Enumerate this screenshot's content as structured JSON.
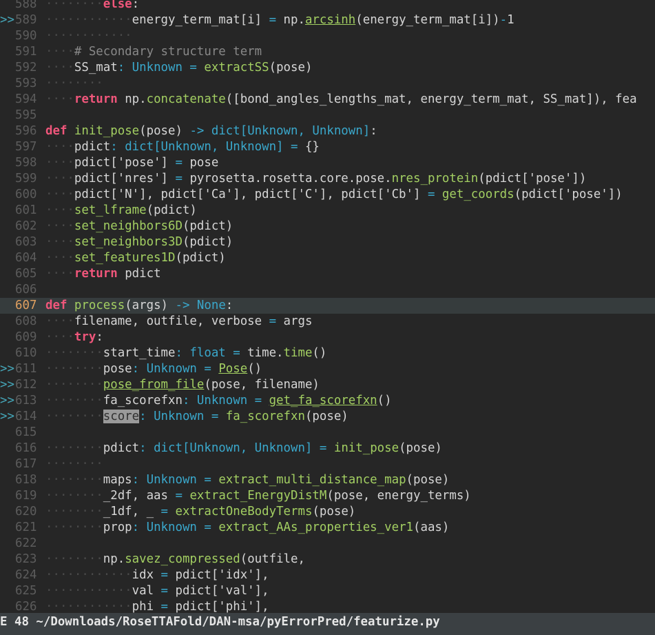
{
  "file_path": "~/Downloads/RoseTTAFold/DAN-msa/pyErrorPred/featurize.py",
  "status_mode": "E",
  "status_count": "48",
  "lines": [
    {
      "n": "588",
      "sign": "",
      "cur": false,
      "t": [
        [
          "ws",
          "········"
        ],
        [
          "kw",
          "else"
        ],
        [
          "plain",
          ":"
        ]
      ]
    },
    {
      "n": "589",
      "sign": ">>",
      "cur": false,
      "t": [
        [
          "ws",
          "············"
        ],
        [
          "plain",
          "energy_term_mat[i] "
        ],
        [
          "ty",
          "="
        ],
        [
          "plain",
          " np."
        ],
        [
          "fn ul",
          "arcsinh"
        ],
        [
          "plain",
          "(energy_term_mat[i])"
        ],
        [
          "ty",
          "-"
        ],
        [
          "plain",
          "1"
        ]
      ]
    },
    {
      "n": "590",
      "sign": "",
      "cur": false,
      "t": [
        [
          "ws",
          "············"
        ]
      ]
    },
    {
      "n": "591",
      "sign": "",
      "cur": false,
      "t": [
        [
          "ws",
          "····"
        ],
        [
          "cm",
          "# Secondary structure term"
        ]
      ]
    },
    {
      "n": "592",
      "sign": "",
      "cur": false,
      "t": [
        [
          "ws",
          "····"
        ],
        [
          "plain",
          "SS_mat"
        ],
        [
          "ty",
          ": Unknown ="
        ],
        [
          "plain",
          " "
        ],
        [
          "fn",
          "extractSS"
        ],
        [
          "plain",
          "(pose)"
        ]
      ]
    },
    {
      "n": "593",
      "sign": "",
      "cur": false,
      "t": [
        [
          "ws",
          "········"
        ]
      ]
    },
    {
      "n": "594",
      "sign": "",
      "cur": false,
      "t": [
        [
          "ws",
          "····"
        ],
        [
          "kw",
          "return"
        ],
        [
          "plain",
          " np."
        ],
        [
          "fn",
          "concatenate"
        ],
        [
          "plain",
          "([bond_angles_lengths_mat, energy_term_mat, SS_mat]), fea"
        ]
      ]
    },
    {
      "n": "595",
      "sign": "",
      "cur": false,
      "t": []
    },
    {
      "n": "596",
      "sign": "",
      "cur": false,
      "t": [
        [
          "kw",
          "def"
        ],
        [
          "plain",
          " "
        ],
        [
          "fn",
          "init_pose"
        ],
        [
          "plain",
          "(pose) "
        ],
        [
          "ty",
          "-> dict[Unknown, Unknown]"
        ],
        [
          "plain",
          ":"
        ]
      ]
    },
    {
      "n": "597",
      "sign": "",
      "cur": false,
      "t": [
        [
          "ws",
          "····"
        ],
        [
          "plain",
          "pdict"
        ],
        [
          "ty",
          ": dict[Unknown, Unknown] ="
        ],
        [
          "plain",
          " {}"
        ]
      ]
    },
    {
      "n": "598",
      "sign": "",
      "cur": false,
      "t": [
        [
          "ws",
          "····"
        ],
        [
          "plain",
          "pdict['pose'] "
        ],
        [
          "ty",
          "="
        ],
        [
          "plain",
          " pose"
        ]
      ]
    },
    {
      "n": "599",
      "sign": "",
      "cur": false,
      "t": [
        [
          "ws",
          "····"
        ],
        [
          "plain",
          "pdict['nres'] "
        ],
        [
          "ty",
          "="
        ],
        [
          "plain",
          " pyrosetta.rosetta.core.pose."
        ],
        [
          "fn",
          "nres_protein"
        ],
        [
          "plain",
          "(pdict['pose'])"
        ]
      ]
    },
    {
      "n": "600",
      "sign": "",
      "cur": false,
      "t": [
        [
          "ws",
          "····"
        ],
        [
          "plain",
          "pdict['N'], pdict['Ca'], pdict['C'], pdict['Cb'] "
        ],
        [
          "ty",
          "="
        ],
        [
          "plain",
          " "
        ],
        [
          "fn",
          "get_coords"
        ],
        [
          "plain",
          "(pdict['pose'])"
        ]
      ]
    },
    {
      "n": "601",
      "sign": "",
      "cur": false,
      "t": [
        [
          "ws",
          "····"
        ],
        [
          "fn",
          "set_lframe"
        ],
        [
          "plain",
          "(pdict)"
        ]
      ]
    },
    {
      "n": "602",
      "sign": "",
      "cur": false,
      "t": [
        [
          "ws",
          "····"
        ],
        [
          "fn",
          "set_neighbors6D"
        ],
        [
          "plain",
          "(pdict)"
        ]
      ]
    },
    {
      "n": "603",
      "sign": "",
      "cur": false,
      "t": [
        [
          "ws",
          "····"
        ],
        [
          "fn",
          "set_neighbors3D"
        ],
        [
          "plain",
          "(pdict)"
        ]
      ]
    },
    {
      "n": "604",
      "sign": "",
      "cur": false,
      "t": [
        [
          "ws",
          "····"
        ],
        [
          "fn",
          "set_features1D"
        ],
        [
          "plain",
          "(pdict)"
        ]
      ]
    },
    {
      "n": "605",
      "sign": "",
      "cur": false,
      "t": [
        [
          "ws",
          "····"
        ],
        [
          "kw",
          "return"
        ],
        [
          "plain",
          " pdict"
        ]
      ]
    },
    {
      "n": "606",
      "sign": "",
      "cur": false,
      "t": []
    },
    {
      "n": "607",
      "sign": "",
      "cur": true,
      "t": [
        [
          "kw",
          "def"
        ],
        [
          "plain",
          " "
        ],
        [
          "fn",
          "process"
        ],
        [
          "plain",
          "(args) "
        ],
        [
          "ty",
          "-> None"
        ],
        [
          "plain",
          ":"
        ]
      ]
    },
    {
      "n": "608",
      "sign": "",
      "cur": false,
      "t": [
        [
          "ws",
          "····"
        ],
        [
          "plain",
          "filename, outfile, verbose "
        ],
        [
          "ty",
          "="
        ],
        [
          "plain",
          " args"
        ]
      ]
    },
    {
      "n": "609",
      "sign": "",
      "cur": false,
      "t": [
        [
          "ws",
          "····"
        ],
        [
          "kw",
          "try"
        ],
        [
          "plain",
          ":"
        ]
      ]
    },
    {
      "n": "610",
      "sign": "",
      "cur": false,
      "t": [
        [
          "ws",
          "········"
        ],
        [
          "plain",
          "start_time"
        ],
        [
          "ty",
          ": float ="
        ],
        [
          "plain",
          " time."
        ],
        [
          "fn",
          "time"
        ],
        [
          "plain",
          "()"
        ]
      ]
    },
    {
      "n": "611",
      "sign": ">>",
      "cur": false,
      "t": [
        [
          "ws",
          "········"
        ],
        [
          "plain",
          "pose"
        ],
        [
          "ty",
          ": Unknown ="
        ],
        [
          "plain",
          " "
        ],
        [
          "fn ul",
          "Pose"
        ],
        [
          "plain",
          "()"
        ]
      ]
    },
    {
      "n": "612",
      "sign": ">>",
      "cur": false,
      "t": [
        [
          "ws",
          "········"
        ],
        [
          "fn ul",
          "pose_from_file"
        ],
        [
          "plain",
          "(pose, filename)"
        ]
      ]
    },
    {
      "n": "613",
      "sign": ">>",
      "cur": false,
      "t": [
        [
          "ws",
          "········"
        ],
        [
          "plain",
          "fa_scorefxn"
        ],
        [
          "ty",
          ": Unknown ="
        ],
        [
          "plain",
          " "
        ],
        [
          "fn ul",
          "get_fa_scorefxn"
        ],
        [
          "plain",
          "()"
        ]
      ]
    },
    {
      "n": "614",
      "sign": ">>",
      "cur": false,
      "t": [
        [
          "ws",
          "········"
        ],
        [
          "hl",
          "score"
        ],
        [
          "ty",
          ": Unknown ="
        ],
        [
          "plain",
          " "
        ],
        [
          "fn",
          "fa_scorefxn"
        ],
        [
          "plain",
          "(pose)"
        ]
      ]
    },
    {
      "n": "615",
      "sign": "",
      "cur": false,
      "t": []
    },
    {
      "n": "616",
      "sign": "",
      "cur": false,
      "t": [
        [
          "ws",
          "········"
        ],
        [
          "plain",
          "pdict"
        ],
        [
          "ty",
          ": dict[Unknown, Unknown] ="
        ],
        [
          "plain",
          " "
        ],
        [
          "fn",
          "init_pose"
        ],
        [
          "plain",
          "(pose)"
        ]
      ]
    },
    {
      "n": "617",
      "sign": "",
      "cur": false,
      "t": [
        [
          "ws",
          "········"
        ]
      ]
    },
    {
      "n": "618",
      "sign": "",
      "cur": false,
      "t": [
        [
          "ws",
          "········"
        ],
        [
          "plain",
          "maps"
        ],
        [
          "ty",
          ": Unknown ="
        ],
        [
          "plain",
          " "
        ],
        [
          "fn",
          "extract_multi_distance_map"
        ],
        [
          "plain",
          "(pose)"
        ]
      ]
    },
    {
      "n": "619",
      "sign": "",
      "cur": false,
      "t": [
        [
          "ws",
          "········"
        ],
        [
          "plain",
          "_2df, aas "
        ],
        [
          "ty",
          "="
        ],
        [
          "plain",
          " "
        ],
        [
          "fn",
          "extract_EnergyDistM"
        ],
        [
          "plain",
          "(pose, energy_terms)"
        ]
      ]
    },
    {
      "n": "620",
      "sign": "",
      "cur": false,
      "t": [
        [
          "ws",
          "········"
        ],
        [
          "plain",
          "_1df, _ "
        ],
        [
          "ty",
          "="
        ],
        [
          "plain",
          " "
        ],
        [
          "fn",
          "extractOneBodyTerms"
        ],
        [
          "plain",
          "(pose)"
        ]
      ]
    },
    {
      "n": "621",
      "sign": "",
      "cur": false,
      "t": [
        [
          "ws",
          "········"
        ],
        [
          "plain",
          "prop"
        ],
        [
          "ty",
          ": Unknown ="
        ],
        [
          "plain",
          " "
        ],
        [
          "fn",
          "extract_AAs_properties_ver1"
        ],
        [
          "plain",
          "(aas)"
        ]
      ]
    },
    {
      "n": "622",
      "sign": "",
      "cur": false,
      "t": []
    },
    {
      "n": "623",
      "sign": "",
      "cur": false,
      "t": [
        [
          "ws",
          "········"
        ],
        [
          "plain",
          "np."
        ],
        [
          "fn",
          "savez_compressed"
        ],
        [
          "plain",
          "(outfile,"
        ]
      ]
    },
    {
      "n": "624",
      "sign": "",
      "cur": false,
      "t": [
        [
          "ws",
          "············"
        ],
        [
          "plain",
          "idx "
        ],
        [
          "ty",
          "="
        ],
        [
          "plain",
          " pdict['idx'],"
        ]
      ]
    },
    {
      "n": "625",
      "sign": "",
      "cur": false,
      "t": [
        [
          "ws",
          "············"
        ],
        [
          "plain",
          "val "
        ],
        [
          "ty",
          "="
        ],
        [
          "plain",
          " pdict['val'],"
        ]
      ]
    },
    {
      "n": "626",
      "sign": "",
      "cur": false,
      "t": [
        [
          "ws",
          "············"
        ],
        [
          "plain",
          "phi "
        ],
        [
          "ty",
          "="
        ],
        [
          "plain",
          " pdict['phi'],"
        ]
      ]
    }
  ]
}
